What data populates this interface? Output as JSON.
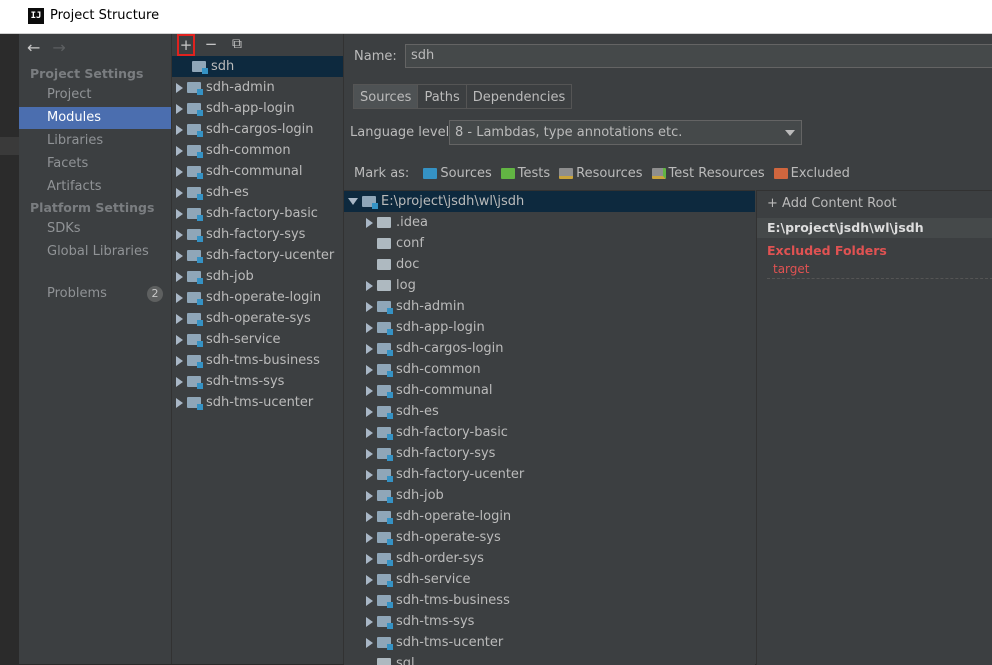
{
  "window": {
    "title": "Project Structure",
    "app_icon": "IJ"
  },
  "sidebar": {
    "back": "←",
    "forward": "→",
    "project_settings_header": "Project Settings",
    "platform_settings_header": "Platform Settings",
    "project_items": [
      "Project",
      "Modules",
      "Libraries",
      "Facets",
      "Artifacts"
    ],
    "platform_items": [
      "SDKs",
      "Global Libraries"
    ],
    "problems_label": "Problems",
    "problems_count": "2",
    "selected": "Modules"
  },
  "module_toolbar": {
    "add": "+",
    "remove": "−",
    "copy": "⧉"
  },
  "modules": [
    "sdh",
    "sdh-admin",
    "sdh-app-login",
    "sdh-cargos-login",
    "sdh-common",
    "sdh-communal",
    "sdh-es",
    "sdh-factory-basic",
    "sdh-factory-sys",
    "sdh-factory-ucenter",
    "sdh-job",
    "sdh-operate-login",
    "sdh-operate-sys",
    "sdh-service",
    "sdh-tms-business",
    "sdh-tms-sys",
    "sdh-tms-ucenter"
  ],
  "main": {
    "name_label": "Name:",
    "name_value": "sdh",
    "tabs": [
      "Sources",
      "Paths",
      "Dependencies"
    ],
    "active_tab": "Sources",
    "language_level_label": "Language level:",
    "language_level_value": "8 - Lambdas, type annotations etc.",
    "mark_as_label": "Mark as:",
    "mark_as": [
      {
        "label": "Sources",
        "color": "#3592c4"
      },
      {
        "label": "Tests",
        "color": "#62b543"
      },
      {
        "label": "Resources",
        "color": "#8e8e8e"
      },
      {
        "label": "Test Resources",
        "color": "#8e8e8e"
      },
      {
        "label": "Excluded",
        "color": "#d0663e"
      }
    ]
  },
  "content_tree": {
    "root": "E:\\project\\jsdh\\wl\\jsdh",
    "children": [
      {
        "label": ".idea",
        "expandable": true
      },
      {
        "label": "conf",
        "expandable": false
      },
      {
        "label": "doc",
        "expandable": false
      },
      {
        "label": "log",
        "expandable": true
      },
      {
        "label": "sdh-admin",
        "expandable": true
      },
      {
        "label": "sdh-app-login",
        "expandable": true
      },
      {
        "label": "sdh-cargos-login",
        "expandable": true
      },
      {
        "label": "sdh-common",
        "expandable": true
      },
      {
        "label": "sdh-communal",
        "expandable": true
      },
      {
        "label": "sdh-es",
        "expandable": true
      },
      {
        "label": "sdh-factory-basic",
        "expandable": true
      },
      {
        "label": "sdh-factory-sys",
        "expandable": true
      },
      {
        "label": "sdh-factory-ucenter",
        "expandable": true
      },
      {
        "label": "sdh-job",
        "expandable": true
      },
      {
        "label": "sdh-operate-login",
        "expandable": true
      },
      {
        "label": "sdh-operate-sys",
        "expandable": true
      },
      {
        "label": "sdh-order-sys",
        "expandable": true
      },
      {
        "label": "sdh-service",
        "expandable": true
      },
      {
        "label": "sdh-tms-business",
        "expandable": true
      },
      {
        "label": "sdh-tms-sys",
        "expandable": true
      },
      {
        "label": "sdh-tms-ucenter",
        "expandable": true
      },
      {
        "label": "sql",
        "expandable": false
      }
    ]
  },
  "content_root_panel": {
    "add_content_root": "Add Content Root",
    "root_path": "E:\\project\\jsdh\\wl\\jsdh",
    "excluded_header": "Excluded Folders",
    "excluded_items": [
      "target"
    ]
  }
}
